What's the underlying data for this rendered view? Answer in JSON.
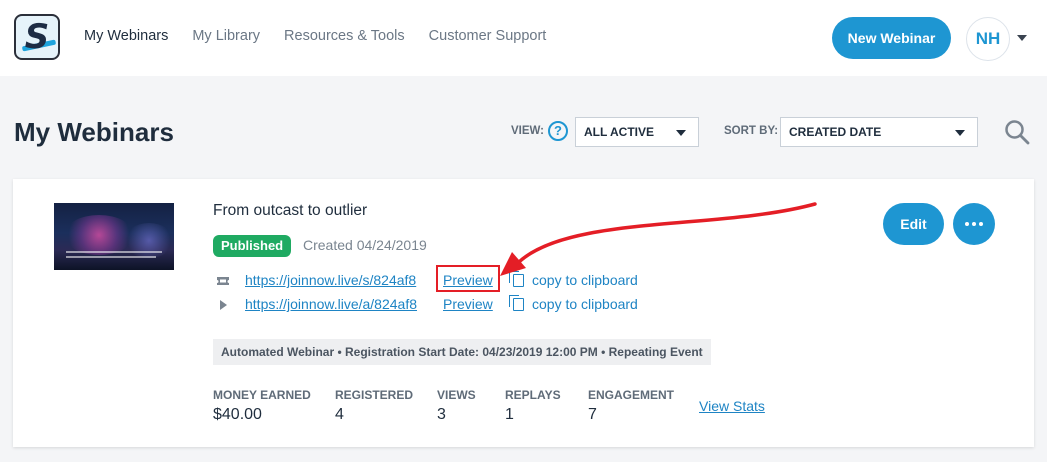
{
  "header": {
    "logo_icon": "shareworks-s-logo-icon",
    "nav": [
      {
        "label": "My Webinars",
        "active": true
      },
      {
        "label": "My Library",
        "active": false
      },
      {
        "label": "Resources & Tools",
        "active": false
      },
      {
        "label": "Customer Support",
        "active": false
      }
    ],
    "new_webinar_label": "New Webinar",
    "avatar_initials": "NH"
  },
  "toolbar": {
    "page_title": "My Webinars",
    "view_label": "VIEW:",
    "view_value": "ALL ACTIVE",
    "sort_label": "SORT BY:",
    "sort_value": "CREATED DATE"
  },
  "webinar": {
    "title": "From outcast to outlier",
    "status": "Published",
    "created": "Created 04/24/2019",
    "links": [
      {
        "icon": "ticket-icon",
        "url": "https://joinnow.live/s/824af8",
        "preview": "Preview",
        "copy": "copy to clipboard"
      },
      {
        "icon": "play-icon",
        "url": "https://joinnow.live/a/824af8",
        "preview": "Preview",
        "copy": "copy to clipboard"
      }
    ],
    "meta": "Automated Webinar • Registration Start Date: 04/23/2019 12:00 PM • Repeating Event",
    "stats": [
      {
        "label": "MONEY EARNED",
        "value": "$40.00"
      },
      {
        "label": "REGISTERED",
        "value": "4"
      },
      {
        "label": "VIEWS",
        "value": "3"
      },
      {
        "label": "REPLAYS",
        "value": "1"
      },
      {
        "label": "ENGAGEMENT",
        "value": "7"
      }
    ],
    "view_stats_label": "View Stats",
    "edit_label": "Edit"
  },
  "colors": {
    "accent": "#1e96d2",
    "published": "#1faa62",
    "annotation": "#e41e26"
  }
}
